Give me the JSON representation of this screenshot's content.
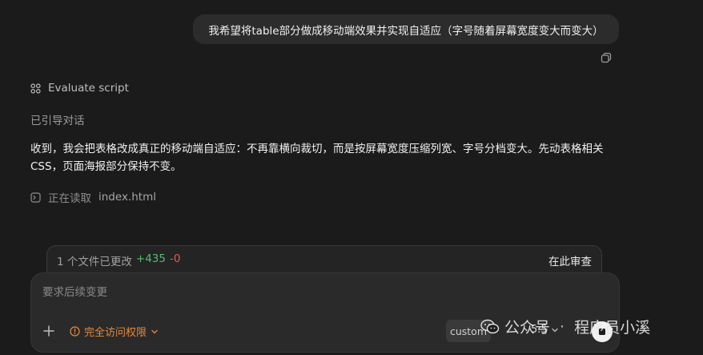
{
  "user_message": "我希望将table部分做成移动端效果并实现自适应（字号随着屏幕宽度变大而变大）",
  "step": {
    "label": "Evaluate script",
    "icon": "grid-icon"
  },
  "guide_label": "已引导对话",
  "assistant_message": "收到，我会把表格改成真正的移动端自适应：不再靠横向裁切，而是按屏幕宽度压缩列宽、字号分档变大。先动表格相关 CSS，页面海报部分保持不变。",
  "reading": {
    "label": "正在读取",
    "file": "index.html"
  },
  "changes": {
    "summary": "1 个文件已更改",
    "added": "+435",
    "removed": "-0",
    "review_label": "在此审查"
  },
  "composer": {
    "placeholder": "要求后续变更",
    "access_label": "完全访问权限",
    "custom_label": "custom",
    "model_label": "5.5"
  },
  "watermark": {
    "left": "公众号",
    "right": "程序员小溪"
  },
  "colors": {
    "background": "#1b1b1b",
    "added": "#4fbf6a",
    "removed": "#e15a5a",
    "access": "#e8893a"
  }
}
